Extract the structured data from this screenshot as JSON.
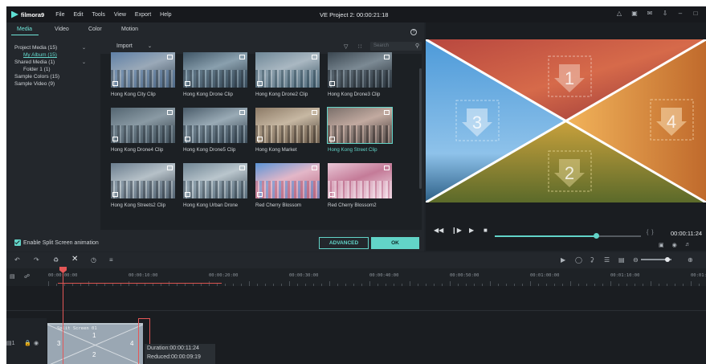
{
  "app": {
    "logo": "filmora9",
    "menu": [
      "File",
      "Edit",
      "Tools",
      "View",
      "Export",
      "Help"
    ],
    "window_title": "VE Project 2: 00:00:21:18"
  },
  "media_panel": {
    "tabs": [
      "Media",
      "Video",
      "Color",
      "Motion"
    ],
    "active_tab": "Media",
    "tree": {
      "project_media": "Project Media (15)",
      "my_album": "My Album (15)",
      "shared_media": "Shared Media (1)",
      "folder": "Folder 1 (1)",
      "sample_colors": "Sample Colors (15)",
      "sample_video": "Sample Video (9)"
    },
    "import_label": "Import",
    "search_placeholder": "Search",
    "clips": [
      {
        "name": "Hong Kong City Clip",
        "theme": "city"
      },
      {
        "name": "Hong Kong Drone Clip",
        "theme": "drone"
      },
      {
        "name": "Hong Kong Drone2 Clip",
        "theme": "drone2"
      },
      {
        "name": "Hong Kong Drone3 Clip",
        "theme": "drone3"
      },
      {
        "name": "Hong Kong Drone4 Clip",
        "theme": "drone4"
      },
      {
        "name": "Hong Kong Drone5 Clip",
        "theme": "drone5"
      },
      {
        "name": "Hong Kong Market",
        "theme": "market"
      },
      {
        "name": "Hong Kong Street Clip",
        "theme": "street",
        "selected": true
      },
      {
        "name": "Hong Kong Streets2 Clip",
        "theme": "streets2"
      },
      {
        "name": "Hong Kong Urban Drone",
        "theme": "urban"
      },
      {
        "name": "Red Cherry Blossom",
        "theme": "blossom"
      },
      {
        "name": "Red Cherry Blossom2",
        "theme": "blossom2"
      }
    ],
    "footer": {
      "split_anim_label": "Enable Split Screen animation",
      "split_anim_checked": true,
      "advanced_label": "ADVANCED",
      "ok_label": "OK"
    }
  },
  "preview": {
    "regions": [
      "1",
      "2",
      "3",
      "4"
    ],
    "timecode": "00:00:11:24",
    "progress": 0.69
  },
  "timeline": {
    "ruler_labels": [
      "00:00:00:00",
      "00:00:10:00",
      "00:00:20:00",
      "00:00:30:00",
      "00:00:40:00",
      "00:00:50:00",
      "00:01:00:00",
      "00:01:10:00",
      "00:01:2"
    ],
    "clip": {
      "title": "Split Screen 01",
      "regions": [
        "1",
        "3",
        "4",
        "2"
      ]
    },
    "tooltip": {
      "duration": "Duration:00:00:11:24",
      "reduced": "Reduced:00:00:09:19"
    }
  },
  "colors": {
    "accent": "#62d4c8",
    "playhead": "#e45757",
    "bg": "#1f2328"
  }
}
